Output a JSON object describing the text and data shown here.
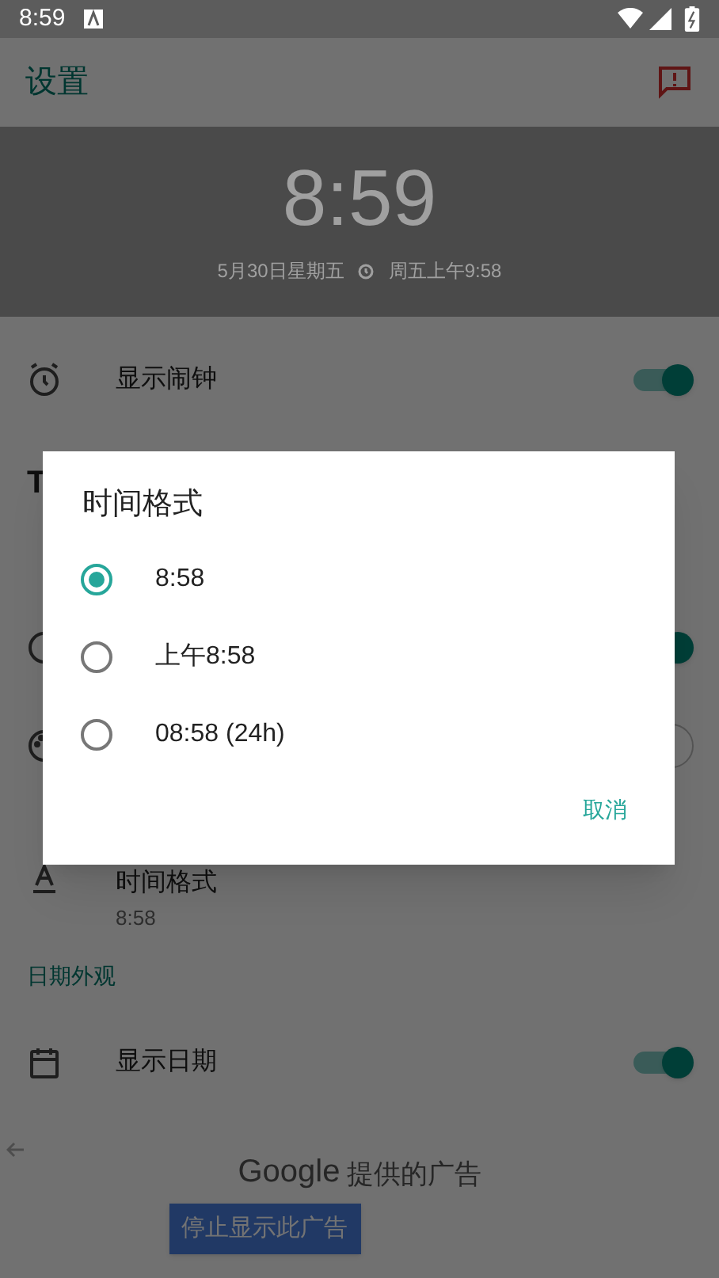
{
  "status_bar": {
    "time": "8:59"
  },
  "app_bar": {
    "title": "设置"
  },
  "clock_preview": {
    "time": "8:59",
    "date": "5月30日星期五",
    "alarm": "周五上午9:58"
  },
  "rows": [
    {
      "kind": "switch",
      "label": "显示闹钟",
      "on": true
    },
    {
      "kind": "heading",
      "label": "T"
    },
    {
      "kind": "section"
    },
    {
      "kind": "switch",
      "on": true
    },
    {
      "kind": "color"
    },
    {
      "kind": "value",
      "label": "时间格式",
      "value": "8:58"
    },
    {
      "kind": "section",
      "label": "日期外观"
    },
    {
      "kind": "switch",
      "label": "显示日期",
      "on": true
    }
  ],
  "ad": {
    "provider": "Google",
    "text": "提供的广告",
    "button": "停止显示此广告"
  },
  "dialog": {
    "title": "时间格式",
    "options": [
      {
        "label": "8:58",
        "selected": true
      },
      {
        "label": "上午8:58",
        "selected": false
      },
      {
        "label": "08:58 (24h)",
        "selected": false
      }
    ],
    "cancel": "取消"
  }
}
